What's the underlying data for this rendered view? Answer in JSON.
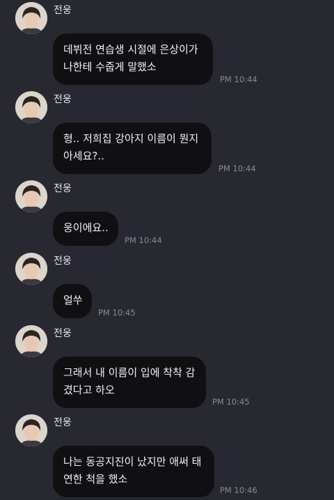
{
  "messages": [
    {
      "sender": "전웅",
      "lines": [
        "데뷔전 연습생 시절에 은상이가",
        "나한테 수줍게 말했소"
      ],
      "time": "PM 10:44"
    },
    {
      "sender": "전웅",
      "lines": [
        "형.. 저희집 강아지 이름이 뭔지",
        "아세요?.."
      ],
      "time": "PM 10:44"
    },
    {
      "sender": "전웅",
      "lines": [
        "웅이에요.."
      ],
      "time": "PM 10:44"
    },
    {
      "sender": "전웅",
      "lines": [
        "얼쑤"
      ],
      "time": "PM 10:45"
    },
    {
      "sender": "전웅",
      "lines": [
        "그래서 내 이름이 입에 착착 감",
        "겼다고 하오"
      ],
      "time": "PM 10:45"
    },
    {
      "sender": "전웅",
      "lines": [
        "나는 동공지진이 났지만 애써 태",
        "연한 척을 했소"
      ],
      "time": "PM 10:46"
    }
  ]
}
